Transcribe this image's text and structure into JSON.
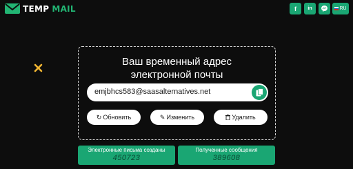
{
  "header": {
    "logo_word1": "TEMP",
    "logo_word2": "MAIL",
    "social": [
      {
        "name": "facebook",
        "glyph": "f"
      },
      {
        "name": "linkedin",
        "glyph": "in"
      },
      {
        "name": "messenger",
        "glyph": "m"
      }
    ],
    "language": "RU"
  },
  "main": {
    "title": "Ваш временный адрес электронной почты",
    "email": "emjbhcs583@saasalternatives.net",
    "buttons": {
      "refresh": "Обновить",
      "change": "Изменить",
      "delete": "Удалить"
    }
  },
  "stats": [
    {
      "label": "Электронные письма созданы",
      "value": "450723"
    },
    {
      "label": "Полученные сообщения",
      "value": "389608"
    }
  ],
  "colors": {
    "background": "#0d0d0d",
    "accent": "#1aa673"
  }
}
